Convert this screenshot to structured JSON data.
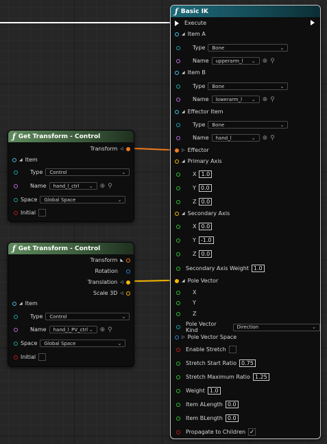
{
  "ik": {
    "title": "Basic IK",
    "execute": "Execute",
    "item_a": "Item A",
    "item_a_type_label": "Type",
    "item_a_type": "Bone",
    "item_a_name_label": "Name",
    "item_a_name": "upperarm_l",
    "item_b": "Item B",
    "item_b_type_label": "Type",
    "item_b_type": "Bone",
    "item_b_name_label": "Name",
    "item_b_name": "lowerarm_l",
    "effector_item": "Effector Item",
    "eff_type_label": "Type",
    "eff_type": "Bone",
    "eff_name_label": "Name",
    "eff_name": "hand_l",
    "effector": "Effector",
    "primary_axis": "Primary Axis",
    "pa_x_label": "X",
    "pa_x": "1.0",
    "pa_y_label": "Y",
    "pa_y": "0.0",
    "pa_z_label": "Z",
    "pa_z": "0.0",
    "secondary_axis": "Secondary Axis",
    "sa_x_label": "X",
    "sa_x": "0.0",
    "sa_y_label": "Y",
    "sa_y": "-1.0",
    "sa_z_label": "Z",
    "sa_z": "0.0",
    "sa_weight_label": "Secondary Axis Weight",
    "sa_weight": "1.0",
    "pole_vector": "Pole Vector",
    "pv_x": "X",
    "pv_y": "Y",
    "pv_z": "Z",
    "pole_kind_label": "Pole Vector Kind",
    "pole_kind": "Direction",
    "pole_space": "Pole Vector Space",
    "enable_stretch": "Enable Stretch",
    "stretch_start_label": "Stretch Start Ratio",
    "stretch_start": "0.75",
    "stretch_max_label": "Stretch Maximum Ratio",
    "stretch_max": "1.25",
    "weight_label": "Weight",
    "weight": "1.0",
    "a_len_label": "Item ALength",
    "a_len": "0.0",
    "b_len_label": "Item BLength",
    "b_len": "0.0",
    "propagate_label": "Propagate to Children",
    "propagate_check": "✓"
  },
  "gt1": {
    "title": "Get Transform - Control",
    "transform": "Transform",
    "item": "Item",
    "type_label": "Type",
    "type": "Control",
    "name_label": "Name",
    "name": "hand_l_ctrl",
    "space_label": "Space",
    "space": "Global Space",
    "initial": "Initial"
  },
  "gt2": {
    "title": "Get Transform - Control",
    "transform": "Transform",
    "rotation": "Rotation",
    "translation": "Translation",
    "scale": "Scale 3D",
    "item": "Item",
    "type_label": "Type",
    "type": "Control",
    "name_label": "Name",
    "name": "hand_l_PV_ctrl",
    "space_label": "Space",
    "space": "Global Space",
    "initial": "Initial"
  },
  "colors": {
    "exec": "#ffffff",
    "transform": "#f27a1a",
    "vector": "#f5b800",
    "float": "#30c030",
    "name": "#b56ee0",
    "enum": "#1aa3a8",
    "bool": "#b51e1e"
  }
}
